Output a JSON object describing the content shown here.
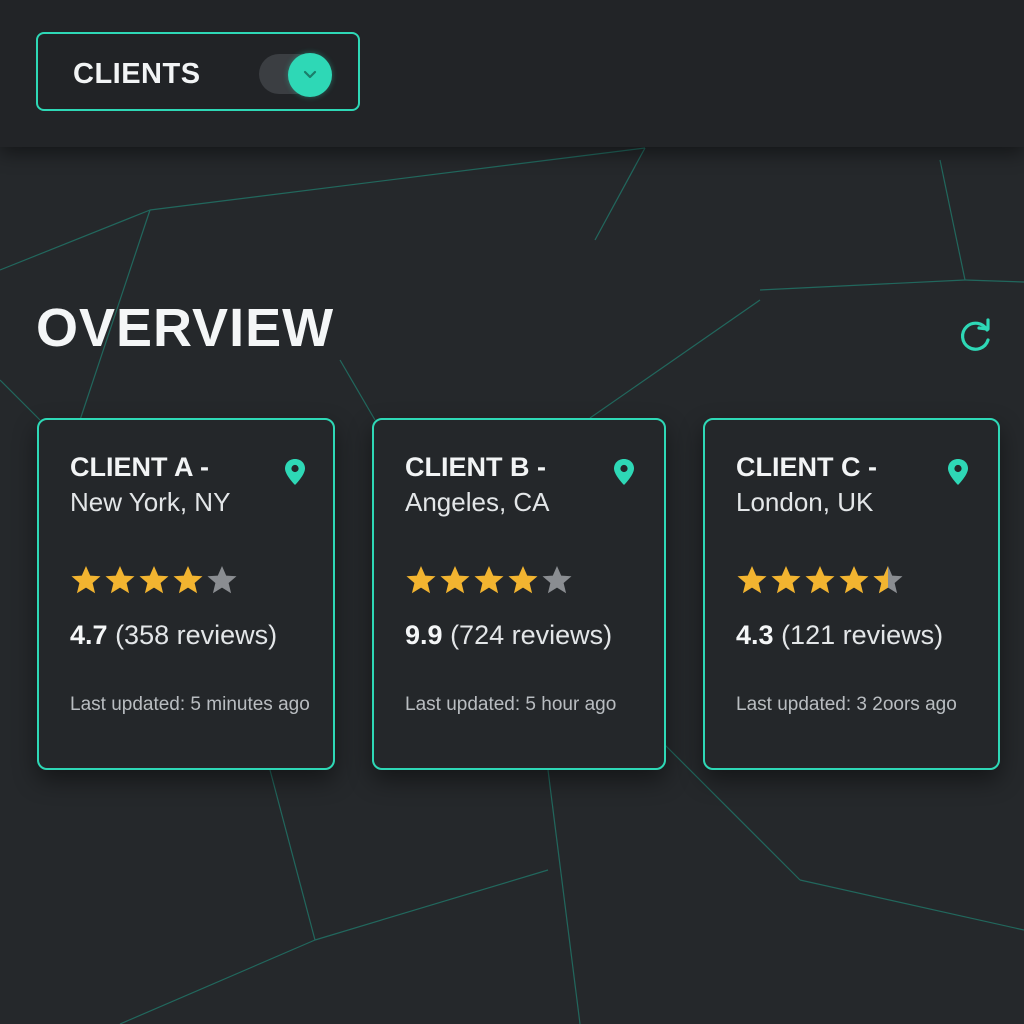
{
  "header": {
    "clients_label": "CLIENTS",
    "toggle_state": "on",
    "toggle_icon": "chevron-down-icon"
  },
  "main": {
    "title": "OVERVIEW",
    "refresh_icon": "refresh-icon"
  },
  "cards": [
    {
      "name": "CLIENT A -",
      "location": "New York, NY",
      "icon": "location-pin-icon",
      "stars": 4,
      "rating": "4.7",
      "reviews": "(358 reviews)",
      "updated": "Last updated: 5 minutes ago"
    },
    {
      "name": "CLIENT B -",
      "location": "Angeles, CA",
      "icon": "location-pin-icon",
      "stars": 4,
      "rating": "9.9",
      "reviews": "(724 reviews)",
      "updated": "Last updated: 5 hour ago"
    },
    {
      "name": "CLIENT C -",
      "location": "London, UK",
      "icon": "location-pin-icon",
      "stars": 4.5,
      "rating": "4.3",
      "reviews": "(121 reviews)",
      "updated": "Last updated: 3 2oors ago"
    }
  ],
  "colors": {
    "accent": "#2ed8b6",
    "background": "#25282b",
    "header_bg": "#222427",
    "star_filled": "#f2b430",
    "star_empty": "#8a8d91"
  }
}
